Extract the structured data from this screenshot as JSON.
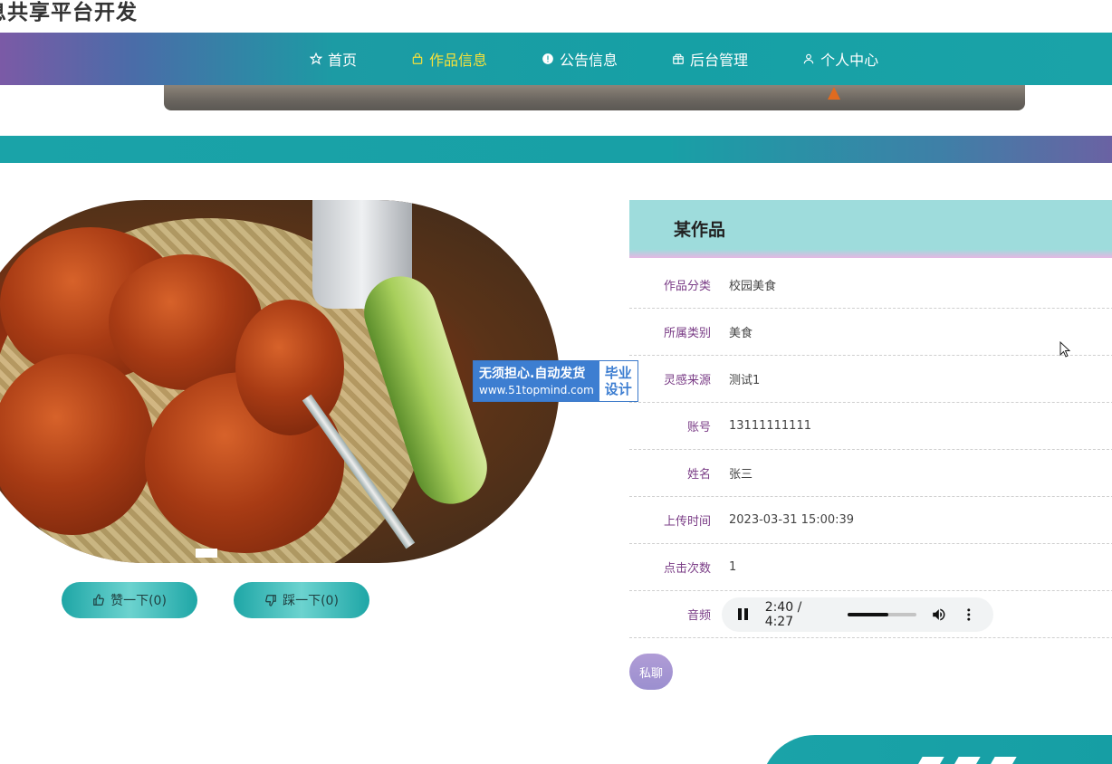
{
  "site": {
    "title": "息共享平台开发"
  },
  "nav": {
    "items": [
      {
        "label": "首页",
        "icon": "star-icon",
        "active": false
      },
      {
        "label": "作品信息",
        "icon": "bag-icon",
        "active": true
      },
      {
        "label": "公告信息",
        "icon": "info-icon",
        "active": false
      },
      {
        "label": "后台管理",
        "icon": "gift-icon",
        "active": false
      },
      {
        "label": "个人中心",
        "icon": "user-icon",
        "active": false
      }
    ],
    "active_color": "#f7e13a",
    "bar_color": "#16a0a5"
  },
  "watermark": {
    "line1": "无须担心.自动发货",
    "line2": "www.51topmind.com",
    "right1": "毕业",
    "right2": "设计"
  },
  "votes": {
    "like_label": "赞一下(0)",
    "dislike_label": "踩一下(0)"
  },
  "detail": {
    "title": "某作品",
    "rows": [
      {
        "label": "作品分类",
        "value": "校园美食"
      },
      {
        "label": "所属类别",
        "value": "美食"
      },
      {
        "label": "灵感来源",
        "value": "测试1"
      },
      {
        "label": "账号",
        "value": "13111111111"
      },
      {
        "label": "姓名",
        "value": "张三"
      },
      {
        "label": "上传时间",
        "value": "2023-03-31 15:00:39"
      },
      {
        "label": "点击次数",
        "value": "1"
      }
    ],
    "audio": {
      "label": "音频",
      "time": "2:40 / 4:27",
      "progress": 0.6
    },
    "chat_label": "私聊"
  }
}
